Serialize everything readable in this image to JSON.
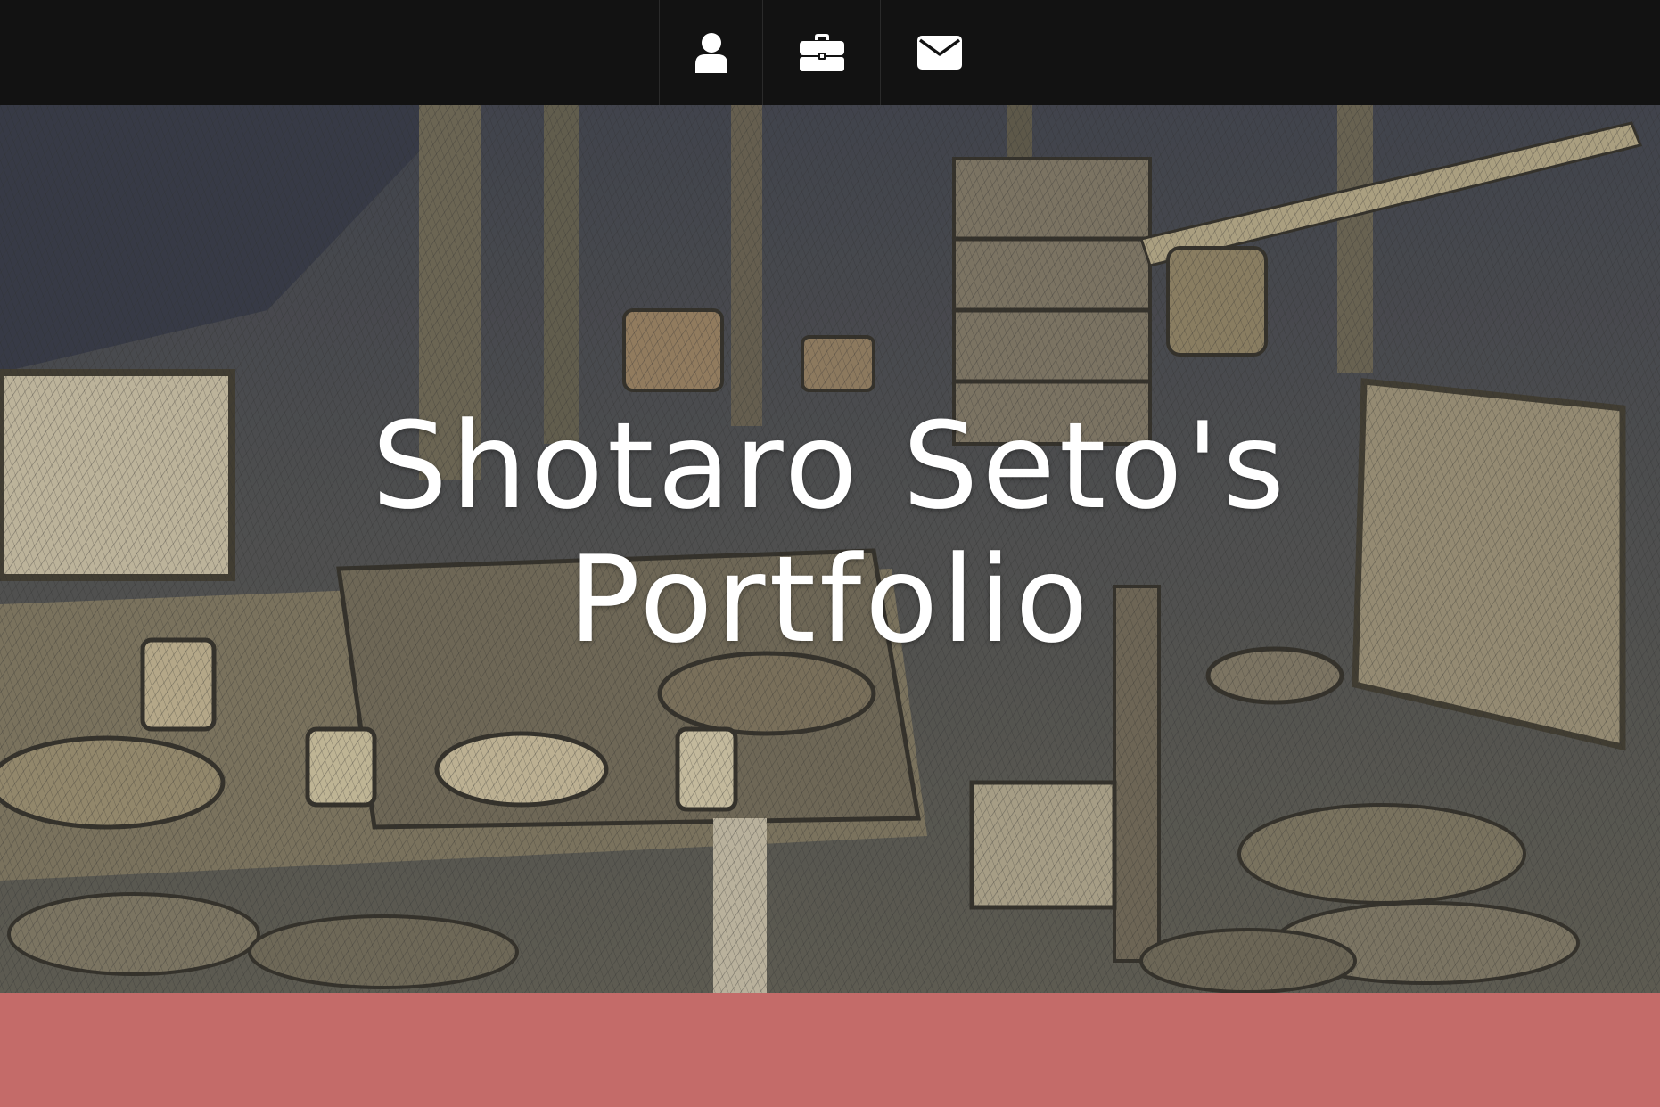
{
  "nav": {
    "items": [
      {
        "icon": "user-icon"
      },
      {
        "icon": "briefcase-icon"
      },
      {
        "icon": "envelope-icon"
      }
    ],
    "background": "#121212",
    "icon_color": "#ffffff"
  },
  "hero": {
    "title_line1": "Shotaro Seto's",
    "title_line2": "Portfolio",
    "background_image": "sketch-style illustration of a rustic cabin interior"
  },
  "colors": {
    "bottom_band": "#c46b69"
  }
}
